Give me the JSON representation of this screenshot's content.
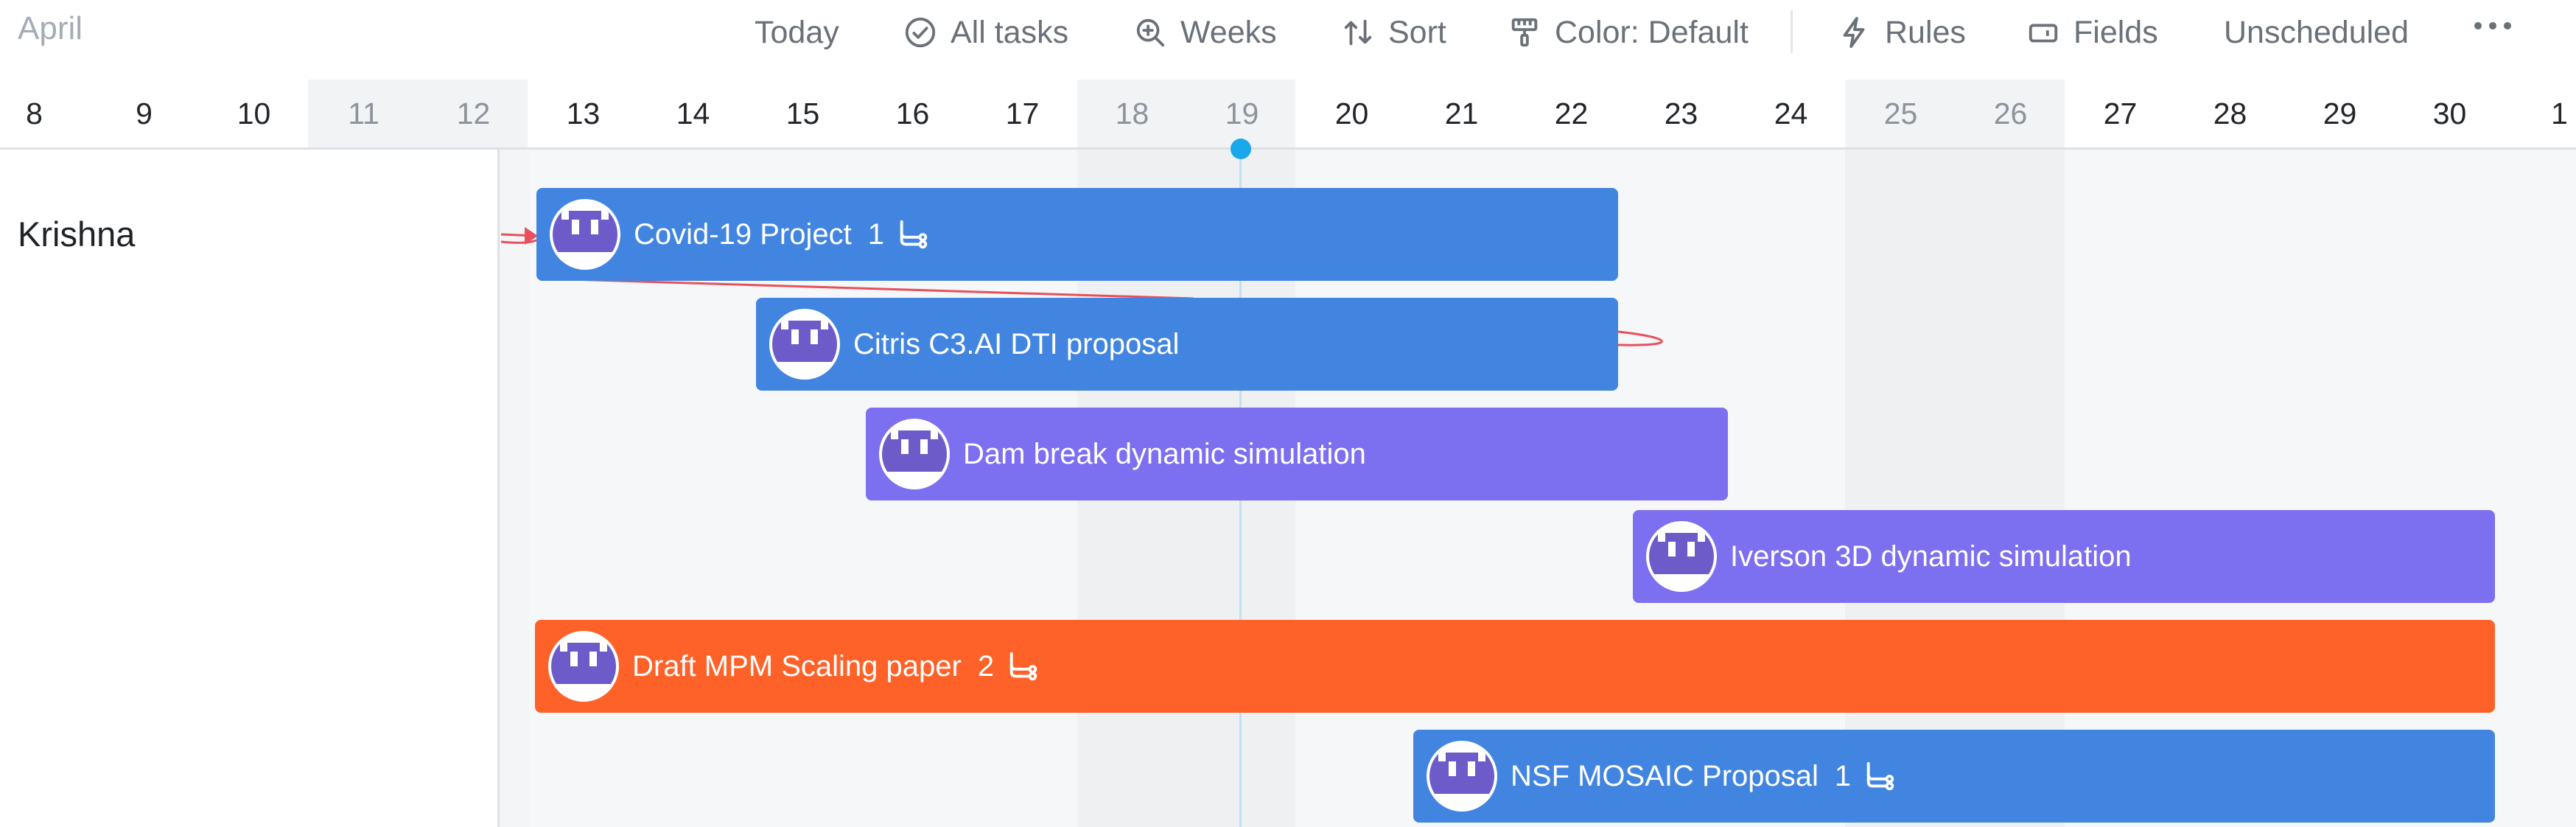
{
  "toolbar": {
    "month": "April",
    "today": "Today",
    "all_tasks": "All tasks",
    "weeks": "Weeks",
    "sort": "Sort",
    "color": "Color: Default",
    "rules": "Rules",
    "fields": "Fields",
    "unscheduled": "Unscheduled"
  },
  "days": [
    "8",
    "9",
    "10",
    "11",
    "12",
    "13",
    "14",
    "15",
    "16",
    "17",
    "18",
    "19",
    "20",
    "21",
    "22",
    "23",
    "24",
    "25",
    "26",
    "27",
    "28",
    "29",
    "30",
    "1"
  ],
  "owner": {
    "name": "Krishna"
  },
  "tasks": [
    {
      "title": "Covid-19 Project",
      "count": "1"
    },
    {
      "title": "Citris C3.AI DTI proposal"
    },
    {
      "title": "Dam break dynamic simulation"
    },
    {
      "title": "Iverson 3D dynamic simulation"
    },
    {
      "title": "Draft MPM Scaling paper",
      "count": "2"
    },
    {
      "title": "NSF MOSAIC Proposal",
      "count": "1"
    }
  ],
  "colors": {
    "blue_bar": "#4285e0",
    "purple_bar": "#7c6ff0",
    "orange_bar": "#ff6229",
    "today_marker": "#1aa7ec",
    "dependency_line": "#e8505b"
  }
}
